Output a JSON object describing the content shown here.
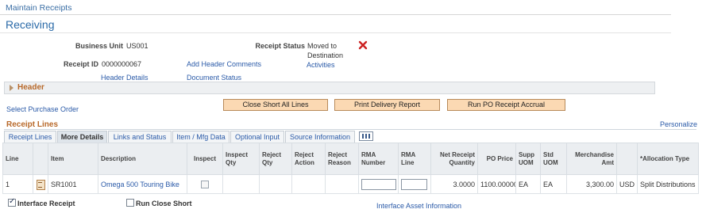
{
  "breadcrumb": "Maintain Receipts",
  "page_title": "Receiving",
  "business_unit": {
    "label": "Business Unit",
    "value": "US001"
  },
  "receipt_id": {
    "label": "Receipt ID",
    "value": "0000000067"
  },
  "receipt_status": {
    "label": "Receipt Status",
    "value_line1": "Moved to",
    "value_line2": "Destination"
  },
  "links": {
    "add_header_comments": "Add Header Comments",
    "activities": "Activities",
    "header_details": "Header Details",
    "document_status": "Document Status",
    "select_purchase_order": "Select Purchase Order",
    "personalize": "Personalize",
    "interface_asset_information": "Interface Asset Information"
  },
  "header_section": {
    "title": "Header",
    "collapsed": true
  },
  "buttons": {
    "close_short": "Close Short All Lines",
    "print_delivery": "Print Delivery Report",
    "run_accrual": "Run PO Receipt Accrual"
  },
  "grid": {
    "title": "Receipt Lines",
    "tabs": [
      "Receipt Lines",
      "More Details",
      "Links and Status",
      "Item / Mfg Data",
      "Optional Input",
      "Source Information"
    ],
    "active_tab": "More Details",
    "columns": [
      "Line",
      "",
      "Item",
      "Description",
      "Inspect",
      "Inspect Qty",
      "Reject Qty",
      "Reject Action",
      "Reject Reason",
      "RMA Number",
      "RMA Line",
      "Net Receipt Quantity",
      "PO Price",
      "Supp UOM",
      "Std UOM",
      "Merchandise Amt",
      "",
      "*Allocation Type"
    ],
    "rows": [
      {
        "line": "1",
        "item": "SR1001",
        "description": "Omega 500 Touring Bike",
        "inspect": false,
        "inspect_qty": "",
        "reject_qty": "",
        "reject_action": "",
        "reject_reason": "",
        "rma_number": "",
        "rma_line": "",
        "net_receipt_quantity": "3.0000",
        "po_price": "1100.00000",
        "supp_uom": "EA",
        "std_uom": "EA",
        "merchandise_amt": "3,300.00",
        "currency": "USD",
        "allocation_type": "Split Distributions"
      }
    ]
  },
  "bottom": {
    "interface_receipt": {
      "label": "Interface Receipt",
      "checked": true
    },
    "run_close_short": {
      "label": "Run Close Short",
      "checked": false
    }
  },
  "colors": {
    "accent_link": "#2a5aa8",
    "section_title": "#b8692a",
    "button_bg": "#fbd9b3",
    "delete_icon": "#cc2222"
  },
  "icons": [
    "delete-x-icon",
    "expand-triangle-icon",
    "grid-view-icon",
    "detail-document-icon"
  ]
}
